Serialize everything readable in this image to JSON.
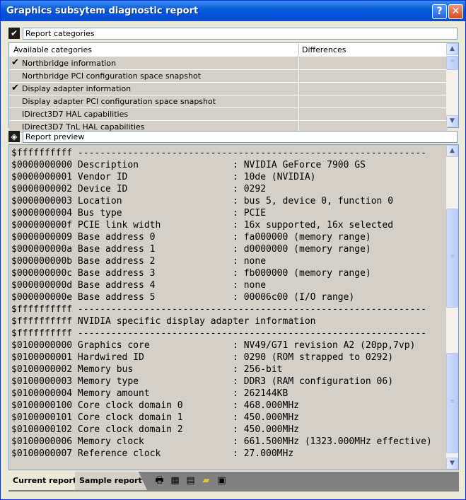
{
  "window": {
    "title": "Graphics subsytem diagnostic report"
  },
  "titlebar": {
    "help_label": "?",
    "close_label": "✕"
  },
  "categories_section": {
    "label": "Report categories",
    "icon": "checkmark-icon"
  },
  "categories_table": {
    "columns": [
      "Available categories",
      "Differences"
    ],
    "rows": [
      {
        "name": "Northbridge information",
        "checked": true
      },
      {
        "name": "Northbridge PCI configuration space snapshot",
        "checked": false
      },
      {
        "name": "Display adapter information",
        "checked": true
      },
      {
        "name": "Display adapter PCI configuration space snapshot",
        "checked": false
      },
      {
        "name": "IDirect3D7 HAL capabilities",
        "checked": false
      },
      {
        "name": "IDirect3D7 TnL HAL capabilities",
        "checked": false
      }
    ]
  },
  "preview_section": {
    "label": "Report preview",
    "icon": "preview-icon"
  },
  "report_lines": [
    "$ffffffffff ---------------------------------------------------------------",
    "$0000000000 Description                 : NVIDIA GeForce 7900 GS",
    "$0000000001 Vendor ID                   : 10de (NVIDIA)",
    "$0000000002 Device ID                   : 0292",
    "$0000000003 Location                    : bus 5, device 0, function 0",
    "$0000000004 Bus type                    : PCIE",
    "$000000000f PCIE link width             : 16x supported, 16x selected",
    "$0000000009 Base address 0              : fa000000 (memory range)",
    "$000000000a Base address 1              : d0000000 (memory range)",
    "$000000000b Base address 2              : none",
    "$000000000c Base address 3              : fb000000 (memory range)",
    "$000000000d Base address 4              : none",
    "$000000000e Base address 5              : 00006c00 (I/O range)",
    "$ffffffffff ---------------------------------------------------------------",
    "$ffffffffff NVIDIA specific display adapter information",
    "$ffffffffff ---------------------------------------------------------------",
    "$0100000000 Graphics core               : NV49/G71 revision A2 (20pp,7vp)",
    "$0100000001 Hardwired ID                : 0290 (ROM strapped to 0292)",
    "$0100000002 Memory bus                  : 256-bit",
    "$0100000003 Memory type                 : DDR3 (RAM configuration 06)",
    "$0100000004 Memory amount               : 262144KB",
    "$0100000100 Core clock domain 0         : 468.000MHz",
    "$0100000101 Core clock domain 1         : 450.000MHz",
    "$0100000102 Core clock domain 2         : 450.000MHz",
    "$0100000006 Memory clock                : 661.500MHz (1323.000MHz effective)",
    "$0100000007 Reference clock             : 27.000MHz"
  ],
  "tabs": [
    {
      "label": "Current report",
      "active": true
    },
    {
      "label": "Sample report",
      "active": false
    }
  ],
  "toolbar": {
    "tools": [
      "printer-icon",
      "view-report-icon",
      "compare-report-icon",
      "open-folder-icon",
      "save-disk-icon"
    ]
  },
  "colors": {
    "titlebar": "#0054e3",
    "row_fill": "#d4d0c8",
    "border": "#7f9db9"
  }
}
